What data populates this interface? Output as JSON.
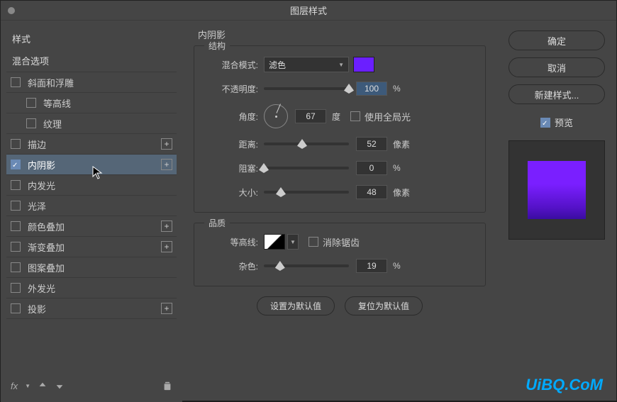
{
  "title": "图层样式",
  "left": {
    "header": "样式",
    "blendOptions": "混合选项",
    "items": [
      {
        "label": "斜面和浮雕",
        "checked": false,
        "indent": false,
        "add": false
      },
      {
        "label": "等高线",
        "checked": false,
        "indent": true,
        "add": false
      },
      {
        "label": "纹理",
        "checked": false,
        "indent": true,
        "add": false
      },
      {
        "label": "描边",
        "checked": false,
        "indent": false,
        "add": true
      },
      {
        "label": "内阴影",
        "checked": true,
        "indent": false,
        "add": true,
        "selected": true
      },
      {
        "label": "内发光",
        "checked": false,
        "indent": false,
        "add": false
      },
      {
        "label": "光泽",
        "checked": false,
        "indent": false,
        "add": false
      },
      {
        "label": "颜色叠加",
        "checked": false,
        "indent": false,
        "add": true
      },
      {
        "label": "渐变叠加",
        "checked": false,
        "indent": false,
        "add": true
      },
      {
        "label": "图案叠加",
        "checked": false,
        "indent": false,
        "add": false
      },
      {
        "label": "外发光",
        "checked": false,
        "indent": false,
        "add": false
      },
      {
        "label": "投影",
        "checked": false,
        "indent": false,
        "add": true
      }
    ],
    "fx": "fx"
  },
  "middle": {
    "panelTitle": "内阴影",
    "structure": {
      "legend": "结构",
      "blendModeLabel": "混合模式:",
      "blendModeValue": "滤色",
      "color": "#6b1fff",
      "opacityLabel": "不透明度:",
      "opacityValue": "100",
      "percent": "%",
      "angleLabel": "角度:",
      "angleValue": "67",
      "degree": "度",
      "globalLightLabel": "使用全局光",
      "distanceLabel": "距离:",
      "distanceValue": "52",
      "pixel": "像素",
      "chokeLabel": "阻塞:",
      "chokeValue": "0",
      "sizeLabel": "大小:",
      "sizeValue": "48"
    },
    "quality": {
      "legend": "品质",
      "contourLabel": "等高线:",
      "antialiasLabel": "消除锯齿",
      "noiseLabel": "杂色:",
      "noiseValue": "19"
    },
    "setDefault": "设置为默认值",
    "resetDefault": "复位为默认值"
  },
  "right": {
    "ok": "确定",
    "cancel": "取消",
    "newStyle": "新建样式...",
    "preview": "预览"
  },
  "watermark": "UiBQ.CoM"
}
